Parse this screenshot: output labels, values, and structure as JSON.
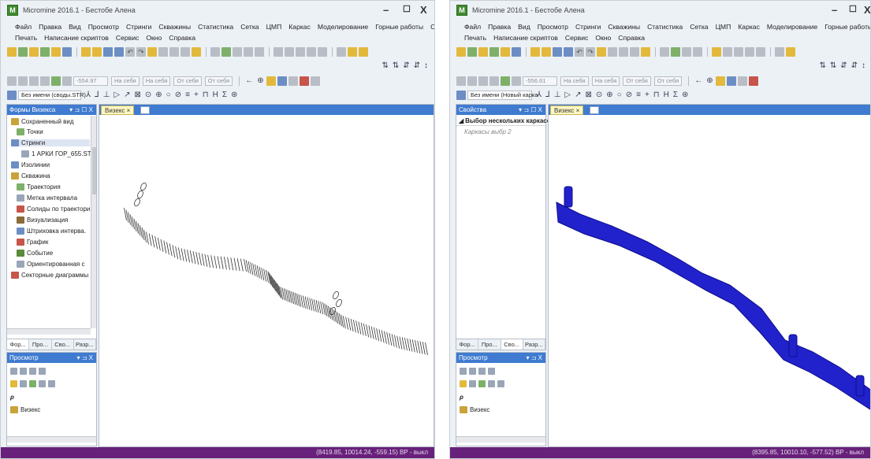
{
  "left": {
    "title": "Micromine 2016.1 - Бестобе Алена",
    "menu_row1": [
      "Файл",
      "Правка",
      "Вид",
      "Просмотр",
      "Стринги",
      "Скважины",
      "Статистика",
      "Сетка",
      "ЦМП",
      "Каркас",
      "Моделирование",
      "Горные работы",
      "Съемка"
    ],
    "menu_row2": [
      "Печать",
      "Написание скриптов",
      "Сервис",
      "Окно",
      "Справка"
    ],
    "elev_value": "-554.97",
    "combo_to1": "На себя",
    "combo_to2": "На себя",
    "combo_from1": "От себя",
    "combo_from2": "От себя",
    "layer_combo": "Без имени (своды.STR)",
    "forms_panel_title": "Формы Визекса",
    "tree": [
      "Сохраненный вид",
      "Точки",
      "Стринги",
      "1 АРКИ ГОР_655.STR",
      "Изолинии",
      "Скважина",
      "Траектория",
      "Метка интервала",
      "Солиды по траектори",
      "Визуализация",
      "Штриховка интерва.",
      "График",
      "Событие",
      "Ориентированная с",
      "Секторные диаграммы"
    ],
    "tabs": [
      "Фор...",
      "Про...",
      "Сво...",
      "Разр..."
    ],
    "preview_title": "Просмотр",
    "preview_item": "Визекс",
    "doc_tab": "Визекс",
    "status": "(8419.85, 10014.24, -559.15)   ВР - выкл"
  },
  "right": {
    "title": "Micromine 2016.1 - Бестобе Алена",
    "menu_row1": [
      "Файл",
      "Правка",
      "Вид",
      "Просмотр",
      "Стринги",
      "Скважины",
      "Статистика",
      "Сетка",
      "ЦМП",
      "Каркас",
      "Моделирование",
      "Горные работы",
      "Съемка"
    ],
    "menu_row2": [
      "Печать",
      "Написание скриптов",
      "Сервис",
      "Окно",
      "Справка"
    ],
    "elev_value": "-556.61",
    "combo_to1": "На себя",
    "combo_to2": "На себя",
    "combo_from1": "От себя",
    "combo_from2": "От себя",
    "layer_combo": "Без имени (Новый карка",
    "props_panel_title": "Свойства",
    "props_header": "Выбор нескольких каркасов",
    "props_item": "Каркасы выбр 2",
    "tabs": [
      "Фор...",
      "Про...",
      "Сво...",
      "Разр..."
    ],
    "preview_title": "Просмотр",
    "preview_item": "Визекс",
    "doc_tab": "Визекс",
    "status": "(8395.85, 10010.10, -577.52)   ВР - выкл"
  },
  "colors": {
    "accent": "#3f7bd0",
    "status": "#68217a",
    "solid": "#2222cc"
  }
}
